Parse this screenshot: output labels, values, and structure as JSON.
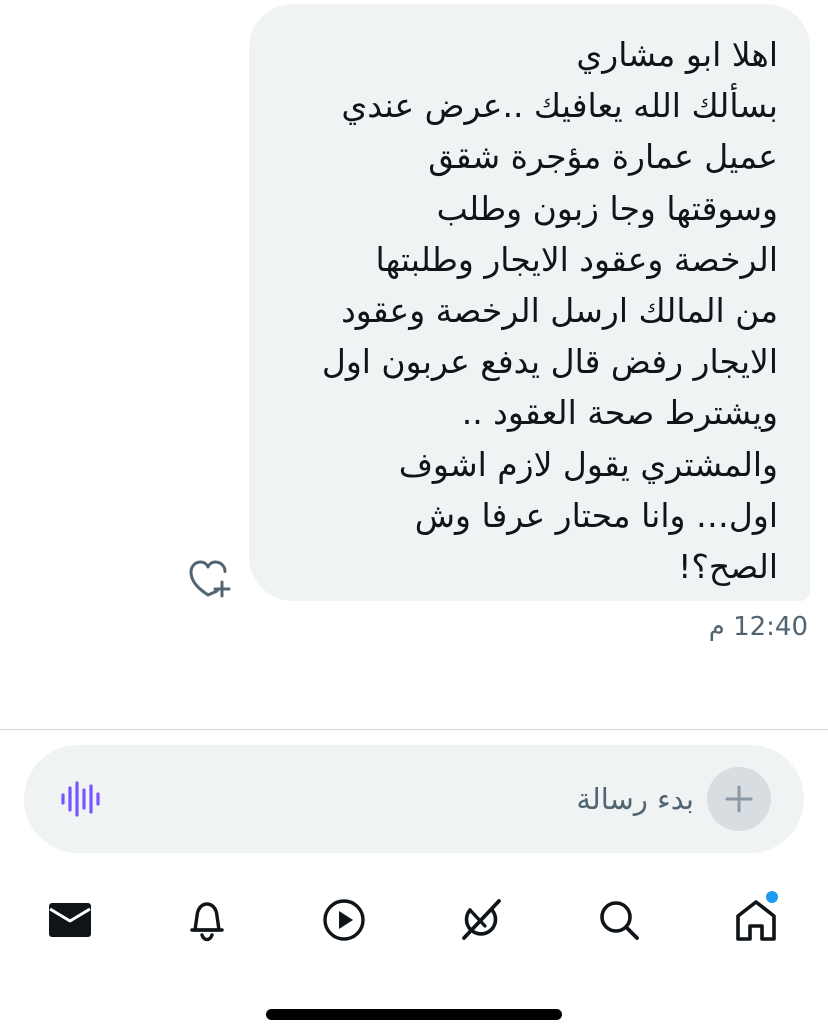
{
  "conversation": {
    "message": {
      "text": "اهلا ابو مشاري\nبسألك الله يعافيك ..عرض عندي\nعميل عمارة مؤجرة شقق\nوسوقتها وجا زبون وطلب\nالرخصة وعقود الايجار وطلبتها\nمن المالك ارسل الرخصة وعقود\nالايجار رفض قال يدفع عربون اول\nويشترط صحة العقود ..\nوالمشتري يقول لازم اشوف\nاول… وانا محتار عرفا وش\nالصح؟!",
      "timestamp": "12:40 م",
      "react_icon": "heart-plus-icon"
    }
  },
  "composer": {
    "placeholder": "بدء رسالة",
    "value": "",
    "voice_icon": "audio-waveform-icon",
    "voice_color": "#7856ff",
    "add_icon": "plus-icon"
  },
  "tab_bar": {
    "tabs": [
      {
        "name": "messages",
        "icon": "envelope-icon",
        "active": true
      },
      {
        "name": "notifications",
        "icon": "bell-icon"
      },
      {
        "name": "video",
        "icon": "play-icon"
      },
      {
        "name": "grok",
        "icon": "grok-icon"
      },
      {
        "name": "search",
        "icon": "search-icon"
      },
      {
        "name": "home",
        "icon": "home-icon",
        "has_notification_dot": true
      }
    ],
    "notification_dot_color": "#1d9bf0"
  },
  "colors": {
    "bubble_background": "#eff3f4",
    "text_primary": "#0f1419",
    "text_secondary": "#536471",
    "divider": "#cfd9de"
  }
}
